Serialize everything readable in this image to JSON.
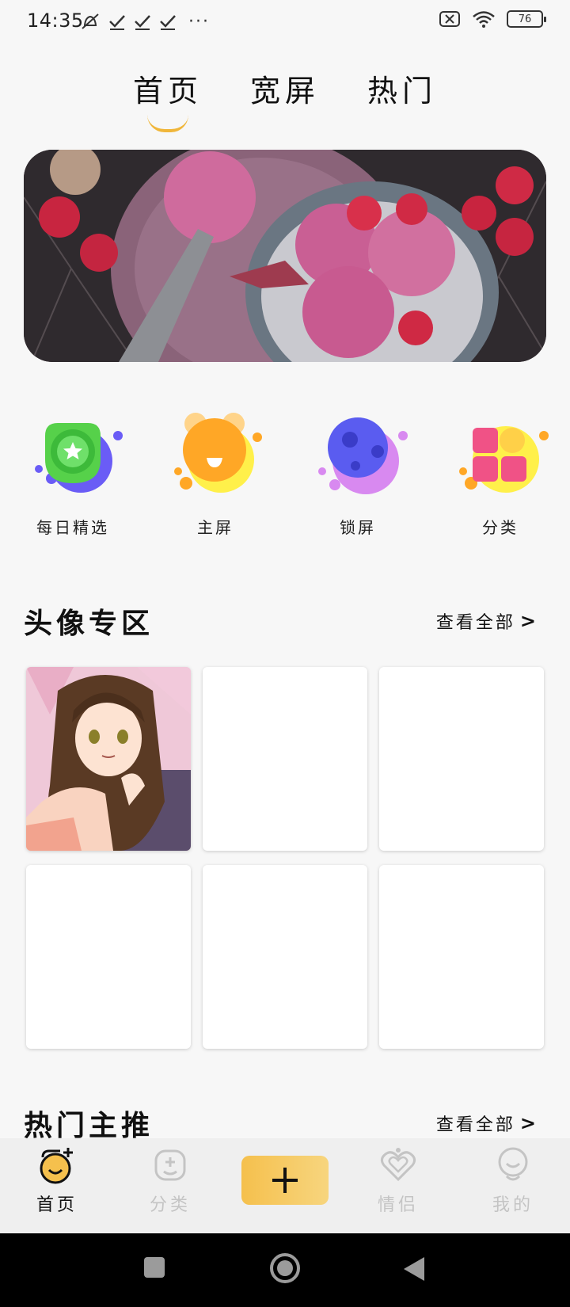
{
  "status_bar": {
    "time": "14:35",
    "battery": "76",
    "more": "···"
  },
  "top_tabs": [
    {
      "label": "首页",
      "active": true
    },
    {
      "label": "宽屏",
      "active": false
    },
    {
      "label": "热门",
      "active": false
    }
  ],
  "categories": [
    {
      "label": "每日精选",
      "icon": "star-badge-icon"
    },
    {
      "label": "主屏",
      "icon": "smiley-bear-icon"
    },
    {
      "label": "锁屏",
      "icon": "planet-icon"
    },
    {
      "label": "分类",
      "icon": "grid-blocks-icon"
    }
  ],
  "avatar_section": {
    "title": "头像专区",
    "more": "查看全部",
    "chevron": ">"
  },
  "hot_section": {
    "title": "热门主推",
    "more": "查看全部",
    "chevron": ">"
  },
  "bottom_nav": {
    "items": [
      {
        "label": "首页",
        "active": true
      },
      {
        "label": "分类",
        "active": false
      },
      {
        "label": "情侣",
        "active": false
      },
      {
        "label": "我的",
        "active": false
      }
    ],
    "add_label": "+"
  },
  "colors": {
    "accent": "#f0b63a",
    "nav_inactive": "#c4c4c4"
  }
}
